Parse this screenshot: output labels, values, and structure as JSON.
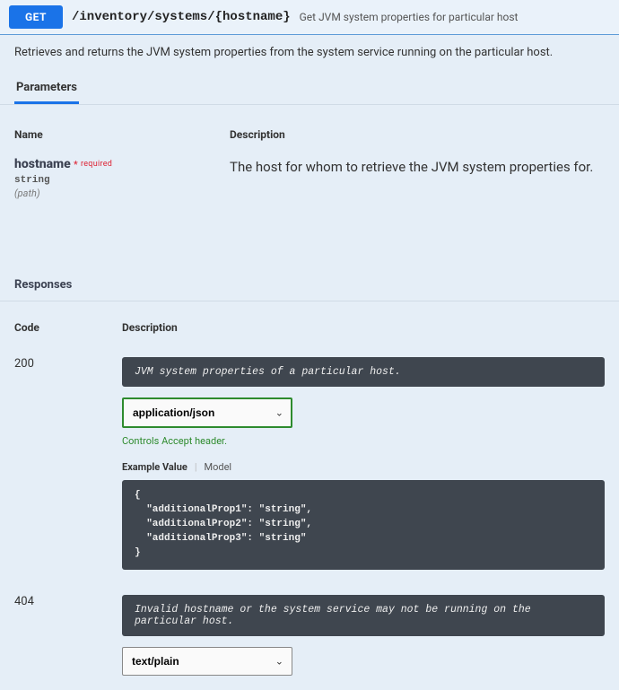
{
  "header": {
    "method": "GET",
    "path": "/inventory/systems/{hostname}",
    "summary": "Get JVM system properties for particular host"
  },
  "description": "Retrieves and returns the JVM system properties from the system service running on the particular host.",
  "tabs": {
    "parameters": "Parameters"
  },
  "param_table": {
    "name_col": "Name",
    "desc_col": "Description"
  },
  "parameters": [
    {
      "name": "hostname",
      "required_star": "*",
      "required_text": "required",
      "type": "string",
      "location": "(path)",
      "description": "The host for whom to retrieve the JVM system properties for."
    }
  ],
  "responses_label": "Responses",
  "resp_table": {
    "code_col": "Code",
    "desc_col": "Description"
  },
  "responses": [
    {
      "code": "200",
      "description": "JVM system properties of a particular host.",
      "media_type": "application/json",
      "accept_note": "Controls Accept header.",
      "example_tabs": {
        "example": "Example Value",
        "model": "Model"
      },
      "example": "{\n  \"additionalProp1\": \"string\",\n  \"additionalProp2\": \"string\",\n  \"additionalProp3\": \"string\"\n}"
    },
    {
      "code": "404",
      "description": "Invalid hostname or the system service may not be running on the particular host.",
      "media_type": "text/plain"
    }
  ]
}
